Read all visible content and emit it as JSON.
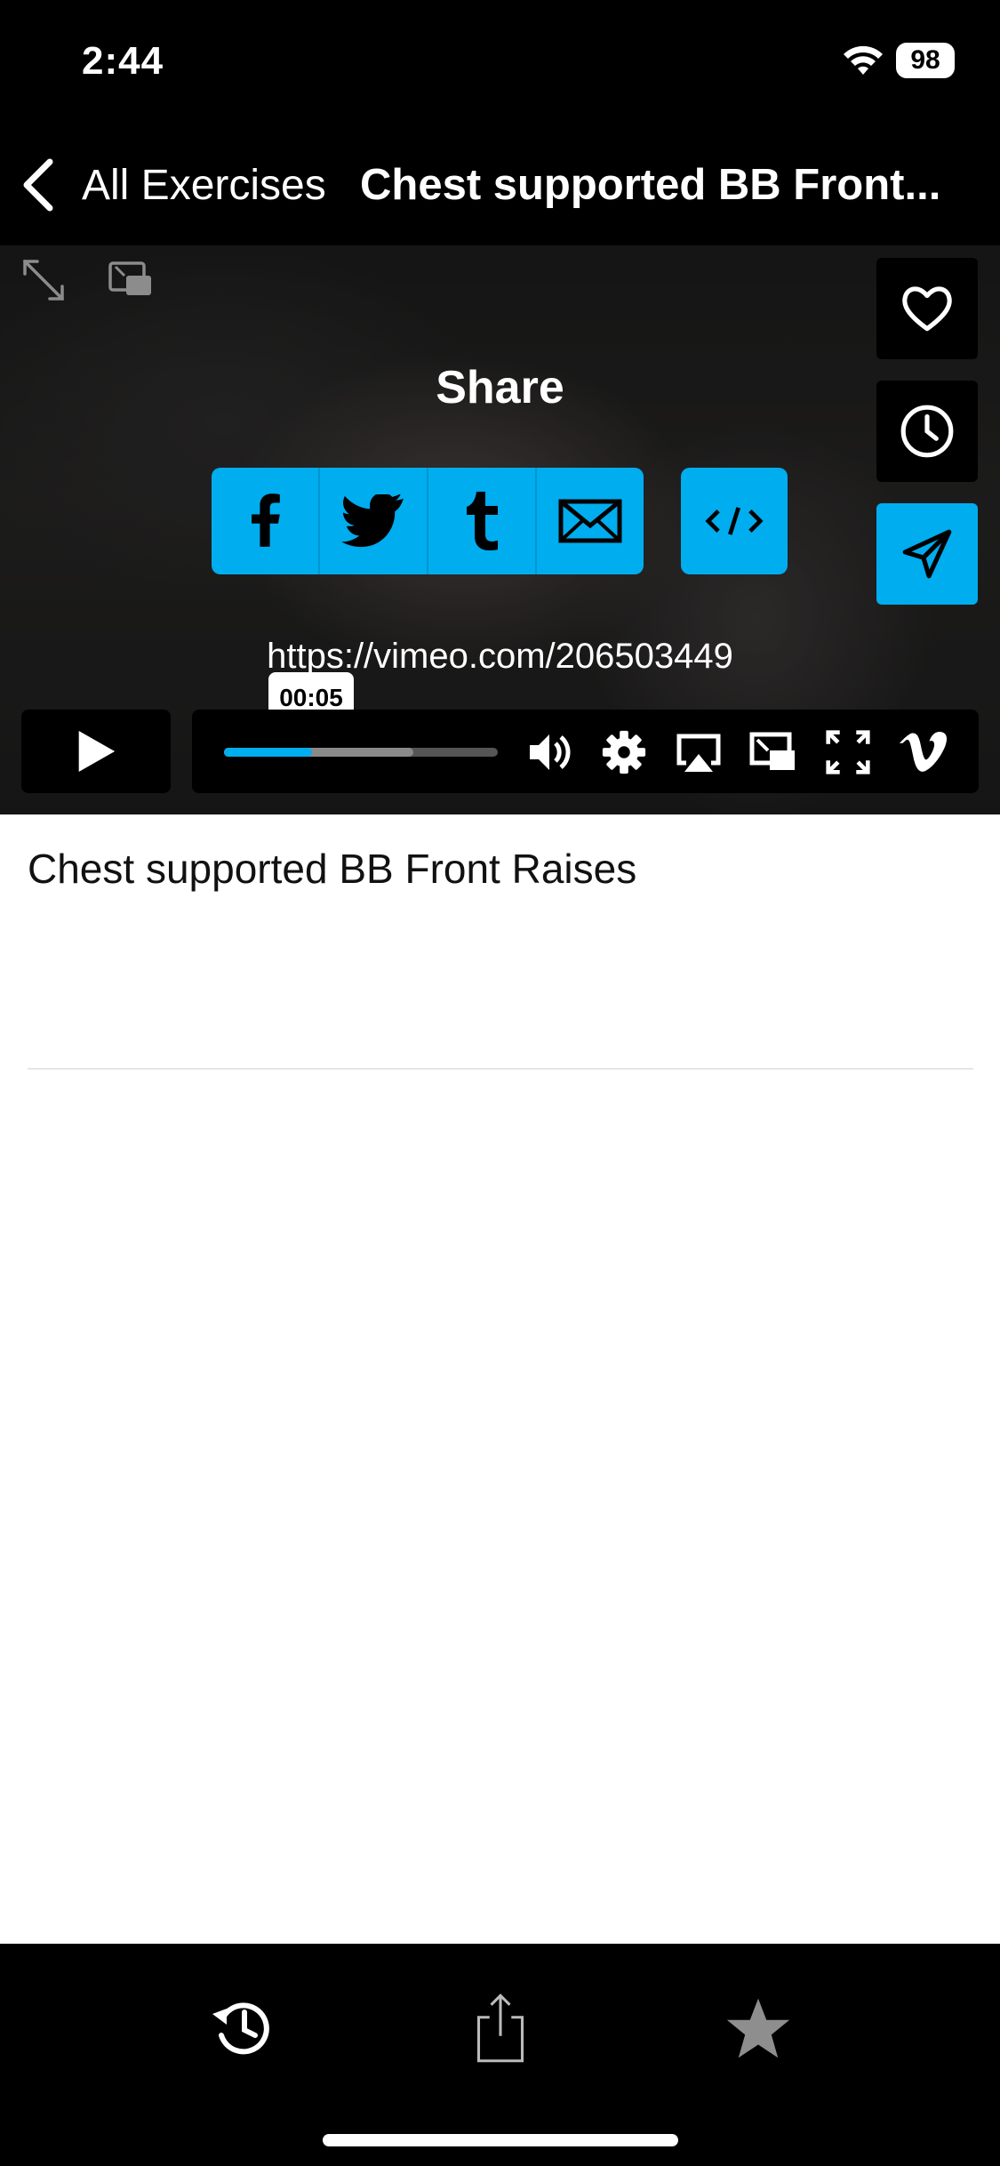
{
  "status_bar": {
    "time": "2:44",
    "battery": "98"
  },
  "nav": {
    "back_label": "All Exercises",
    "title": "Chest supported BB Front..."
  },
  "video": {
    "share_title": "Share",
    "share_url": "https://vimeo.com/206503449",
    "current_time": "00:05",
    "played_fraction": 0.32,
    "loaded_fraction": 0.69,
    "accent_color": "#00adef",
    "share_targets": [
      "facebook-icon",
      "twitter-icon",
      "tumblr-icon",
      "email-icon"
    ],
    "side_buttons": [
      "heart-icon",
      "clock-icon",
      "send-icon"
    ],
    "control_icons": [
      "volume-icon",
      "settings-icon",
      "airplay-icon",
      "pip-icon",
      "fullscreen-icon",
      "vimeo-logo-icon"
    ]
  },
  "content": {
    "exercise_name": "Chest supported BB Front Raises"
  },
  "tab_bar": {
    "items": [
      "history-icon",
      "share-icon",
      "star-icon"
    ]
  }
}
